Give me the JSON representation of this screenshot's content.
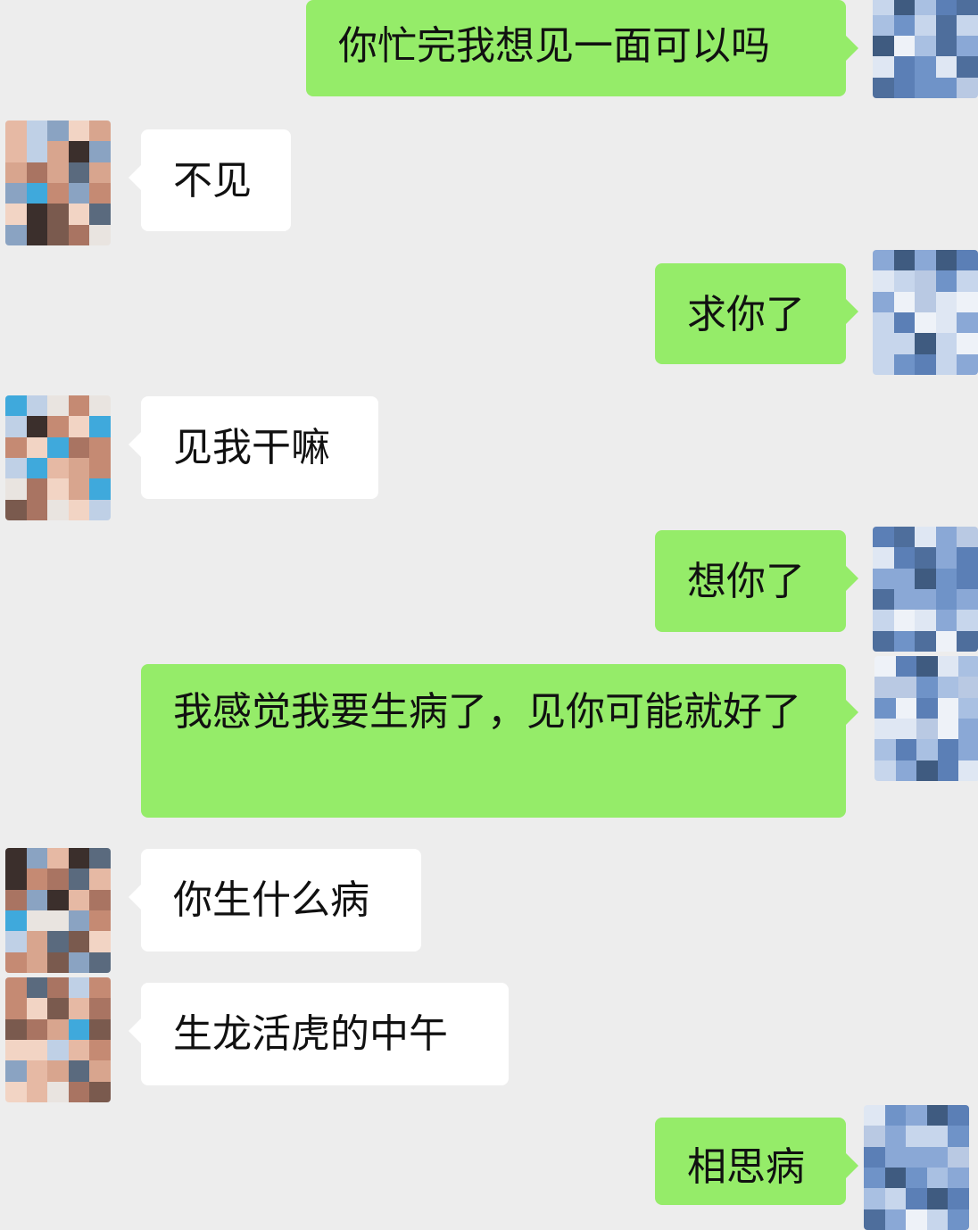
{
  "messages": [
    {
      "sender": "self",
      "text": "你忙完我想见一面可以吗"
    },
    {
      "sender": "other",
      "text": "不见"
    },
    {
      "sender": "self",
      "text": "求你了"
    },
    {
      "sender": "other",
      "text": "见我干嘛"
    },
    {
      "sender": "self",
      "text": "想你了"
    },
    {
      "sender": "self",
      "text": "我感觉我要生病了，见你可能就好了"
    },
    {
      "sender": "other",
      "text": "你生什么病"
    },
    {
      "sender": "other",
      "text": "生龙活虎的中午"
    },
    {
      "sender": "self",
      "text": "相思病"
    }
  ],
  "colors": {
    "background": "#ededed",
    "incoming_bubble": "#ffffff",
    "outgoing_bubble": "#95ec69",
    "text": "#111111"
  },
  "avatars": {
    "self_icon": "pixelated-blue-avatar-icon",
    "other_icon": "pixelated-skin-tone-avatar-icon"
  }
}
